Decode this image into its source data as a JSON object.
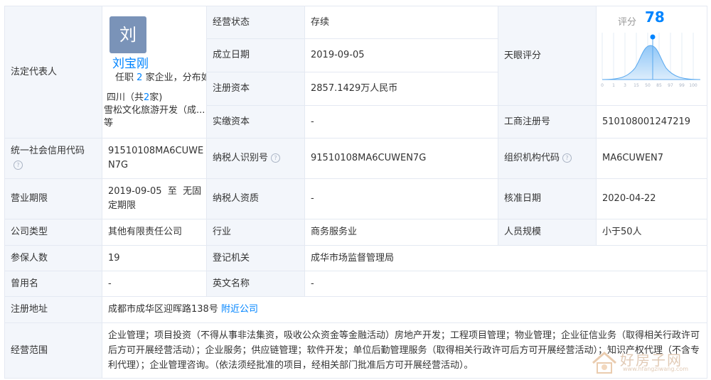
{
  "legal_rep": {
    "label": "法定代表人",
    "avatar_char": "刘",
    "name": "刘宝刚",
    "positions_prefix": "任职",
    "positions_count": "2",
    "positions_suffix": "家企业，分布如下",
    "region": "四川（共",
    "region_count": "2",
    "region_suffix": "家)",
    "company_line1": "雪松文化旅游开发（成...",
    "company_line2": "等"
  },
  "status": {
    "label": "经营状态",
    "value": "存续"
  },
  "founded": {
    "label": "成立日期",
    "value": "2019-09-05"
  },
  "reg_capital": {
    "label": "注册资本",
    "value": "2857.1429万人民币"
  },
  "paid_capital": {
    "label": "实缴资本",
    "value": "-"
  },
  "tianyan": {
    "label": "天眼评分",
    "score_label": "评分",
    "score": "78",
    "axis": [
      "0",
      "1",
      "3",
      "15",
      "50",
      "85",
      "97",
      "99",
      "100"
    ]
  },
  "business_reg_no": {
    "label": "工商注册号",
    "value": "510108001247219"
  },
  "credit_code": {
    "label": "统一社会信用代码",
    "value_line1": "91510108MA6CUWE",
    "value_line2": "N7G"
  },
  "taxpayer_id": {
    "label": "纳税人识别号",
    "value": "91510108MA6CUWEN7G"
  },
  "org_code": {
    "label": "组织机构代码",
    "value": "MA6CUWEN7"
  },
  "term": {
    "label": "营业期限",
    "value_line1": "2019-09-05  至  无固",
    "value_line2": "定期限"
  },
  "taxpayer_qual": {
    "label": "纳税人资质",
    "value": "-"
  },
  "approval_date": {
    "label": "核准日期",
    "value": "2020-04-22"
  },
  "company_type": {
    "label": "公司类型",
    "value": "其他有限责任公司"
  },
  "industry": {
    "label": "行业",
    "value": "商务服务业"
  },
  "staff_size": {
    "label": "人员规模",
    "value": "小于50人"
  },
  "insured": {
    "label": "参保人数",
    "value": "19"
  },
  "reg_authority": {
    "label": "登记机关",
    "value": "成华市场监督管理局"
  },
  "former_name": {
    "label": "曾用名",
    "value": "-"
  },
  "english_name": {
    "label": "英文名称",
    "value": "-"
  },
  "address": {
    "label": "注册地址",
    "value": "成都市成华区迎晖路138号",
    "link": "附近公司"
  },
  "scope": {
    "label": "经营范围",
    "value": "企业管理；项目投资（不得从事非法集资，吸收公众资金等金融活动）房地产开发；工程项目管理；物业管理；企业征信业务（取得相关行政许可后方可开展经营活动）；企业服务；供应链管理；软件开发；单位后勤管理服务（取得相关行政许可后方可开展经营活动）；知识产权代理（不含专利代理）；企业管理咨询。（依法须经批准的项目，经相关部门批准后方可开展经营活动）。"
  },
  "watermark": {
    "text": "好房子网",
    "url": "www.hfangziwang.com"
  }
}
